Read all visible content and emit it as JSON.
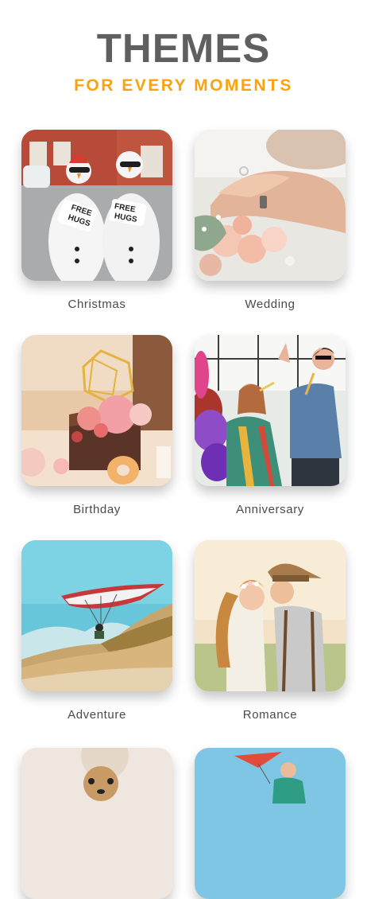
{
  "header": {
    "title": "THEMES",
    "subtitle": "FOR EVERY MOMENTS"
  },
  "themes": [
    {
      "label": "Christmas"
    },
    {
      "label": "Wedding"
    },
    {
      "label": "Birthday"
    },
    {
      "label": "Anniversary"
    },
    {
      "label": "Adventure"
    },
    {
      "label": "Romance"
    },
    {
      "label": "",
      "partial": true
    },
    {
      "label": "",
      "partial": true
    }
  ],
  "sign_text": [
    "FREE",
    "HUGS"
  ],
  "colors": {
    "title": "#5f5f5f",
    "subtitle_accent": "#f9a30f",
    "label": "#4a4a4a",
    "background": "#ffffff"
  }
}
